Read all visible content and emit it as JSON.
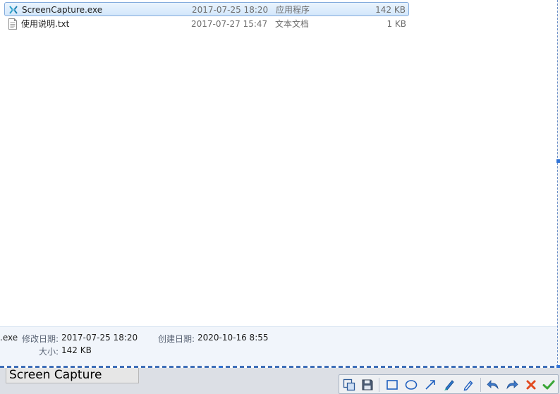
{
  "files": [
    {
      "name": "ScreenCapture.exe",
      "date": "2017-07-25 18:20",
      "type": "应用程序",
      "size": "142 KB",
      "icon": "exe-icon",
      "selected": true
    },
    {
      "name": "使用说明.txt",
      "date": "2017-07-27 15:47",
      "type": "文本文档",
      "size": "1 KB",
      "icon": "text-file-icon",
      "selected": false
    }
  ],
  "details": {
    "filename_fragment": ".exe",
    "modified_label": "修改日期:",
    "modified_value": "2017-07-25 18:20",
    "created_label": "创建日期:",
    "created_value": "2020-10-16 8:55",
    "size_label": "大小:",
    "size_value": "142 KB"
  },
  "capture_title": "Screen Capture",
  "toolbar": {
    "buttons": [
      {
        "name": "select-region-icon"
      },
      {
        "name": "save-icon"
      },
      {
        "name": "rectangle-icon"
      },
      {
        "name": "ellipse-icon"
      },
      {
        "name": "arrow-icon"
      },
      {
        "name": "brush-icon"
      },
      {
        "name": "text-pen-icon"
      },
      {
        "name": "undo-icon"
      },
      {
        "name": "redo-icon"
      },
      {
        "name": "cancel-icon"
      },
      {
        "name": "confirm-icon"
      }
    ]
  }
}
